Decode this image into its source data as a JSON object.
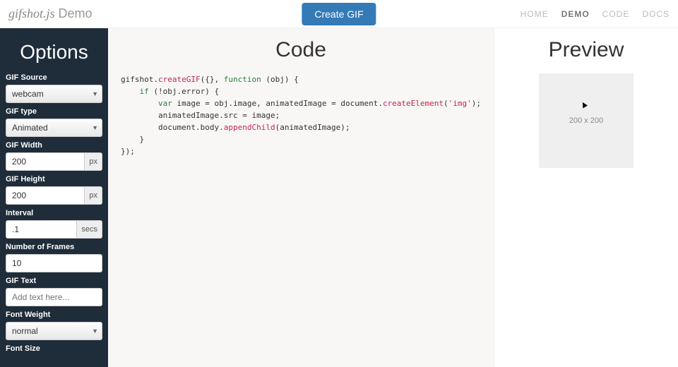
{
  "brand": {
    "name": "gifshot.js",
    "suffix": "Demo"
  },
  "header": {
    "create_btn": "Create GIF"
  },
  "nav": {
    "home": "HOME",
    "demo": "DEMO",
    "code": "CODE",
    "docs": "DOCS"
  },
  "sidebar": {
    "title": "Options",
    "fields": {
      "gif_source": {
        "label": "GIF Source",
        "value": "webcam"
      },
      "gif_type": {
        "label": "GIF type",
        "value": "Animated"
      },
      "gif_width": {
        "label": "GIF Width",
        "value": "200",
        "unit": "px"
      },
      "gif_height": {
        "label": "GIF Height",
        "value": "200",
        "unit": "px"
      },
      "interval": {
        "label": "Interval",
        "value": ".1",
        "unit": "secs"
      },
      "num_frames": {
        "label": "Number of Frames",
        "value": "10"
      },
      "gif_text": {
        "label": "GIF Text",
        "placeholder": "Add text here..."
      },
      "font_weight": {
        "label": "Font Weight",
        "value": "normal"
      },
      "font_size": {
        "label": "Font Size"
      }
    }
  },
  "code": {
    "title": "Code",
    "tokens": {
      "gifshot": "gifshot",
      "createGIF": "createGIF",
      "function": "function",
      "obj": "obj",
      "if": "if",
      "error": "error",
      "var": "var",
      "image": "image",
      "animatedImage": "animatedImage",
      "document": "document",
      "createElement": "createElement",
      "img": "'img'",
      "src": "src",
      "body": "body",
      "appendChild": "appendChild"
    }
  },
  "preview": {
    "title": "Preview",
    "placeholder": "200 x 200"
  }
}
